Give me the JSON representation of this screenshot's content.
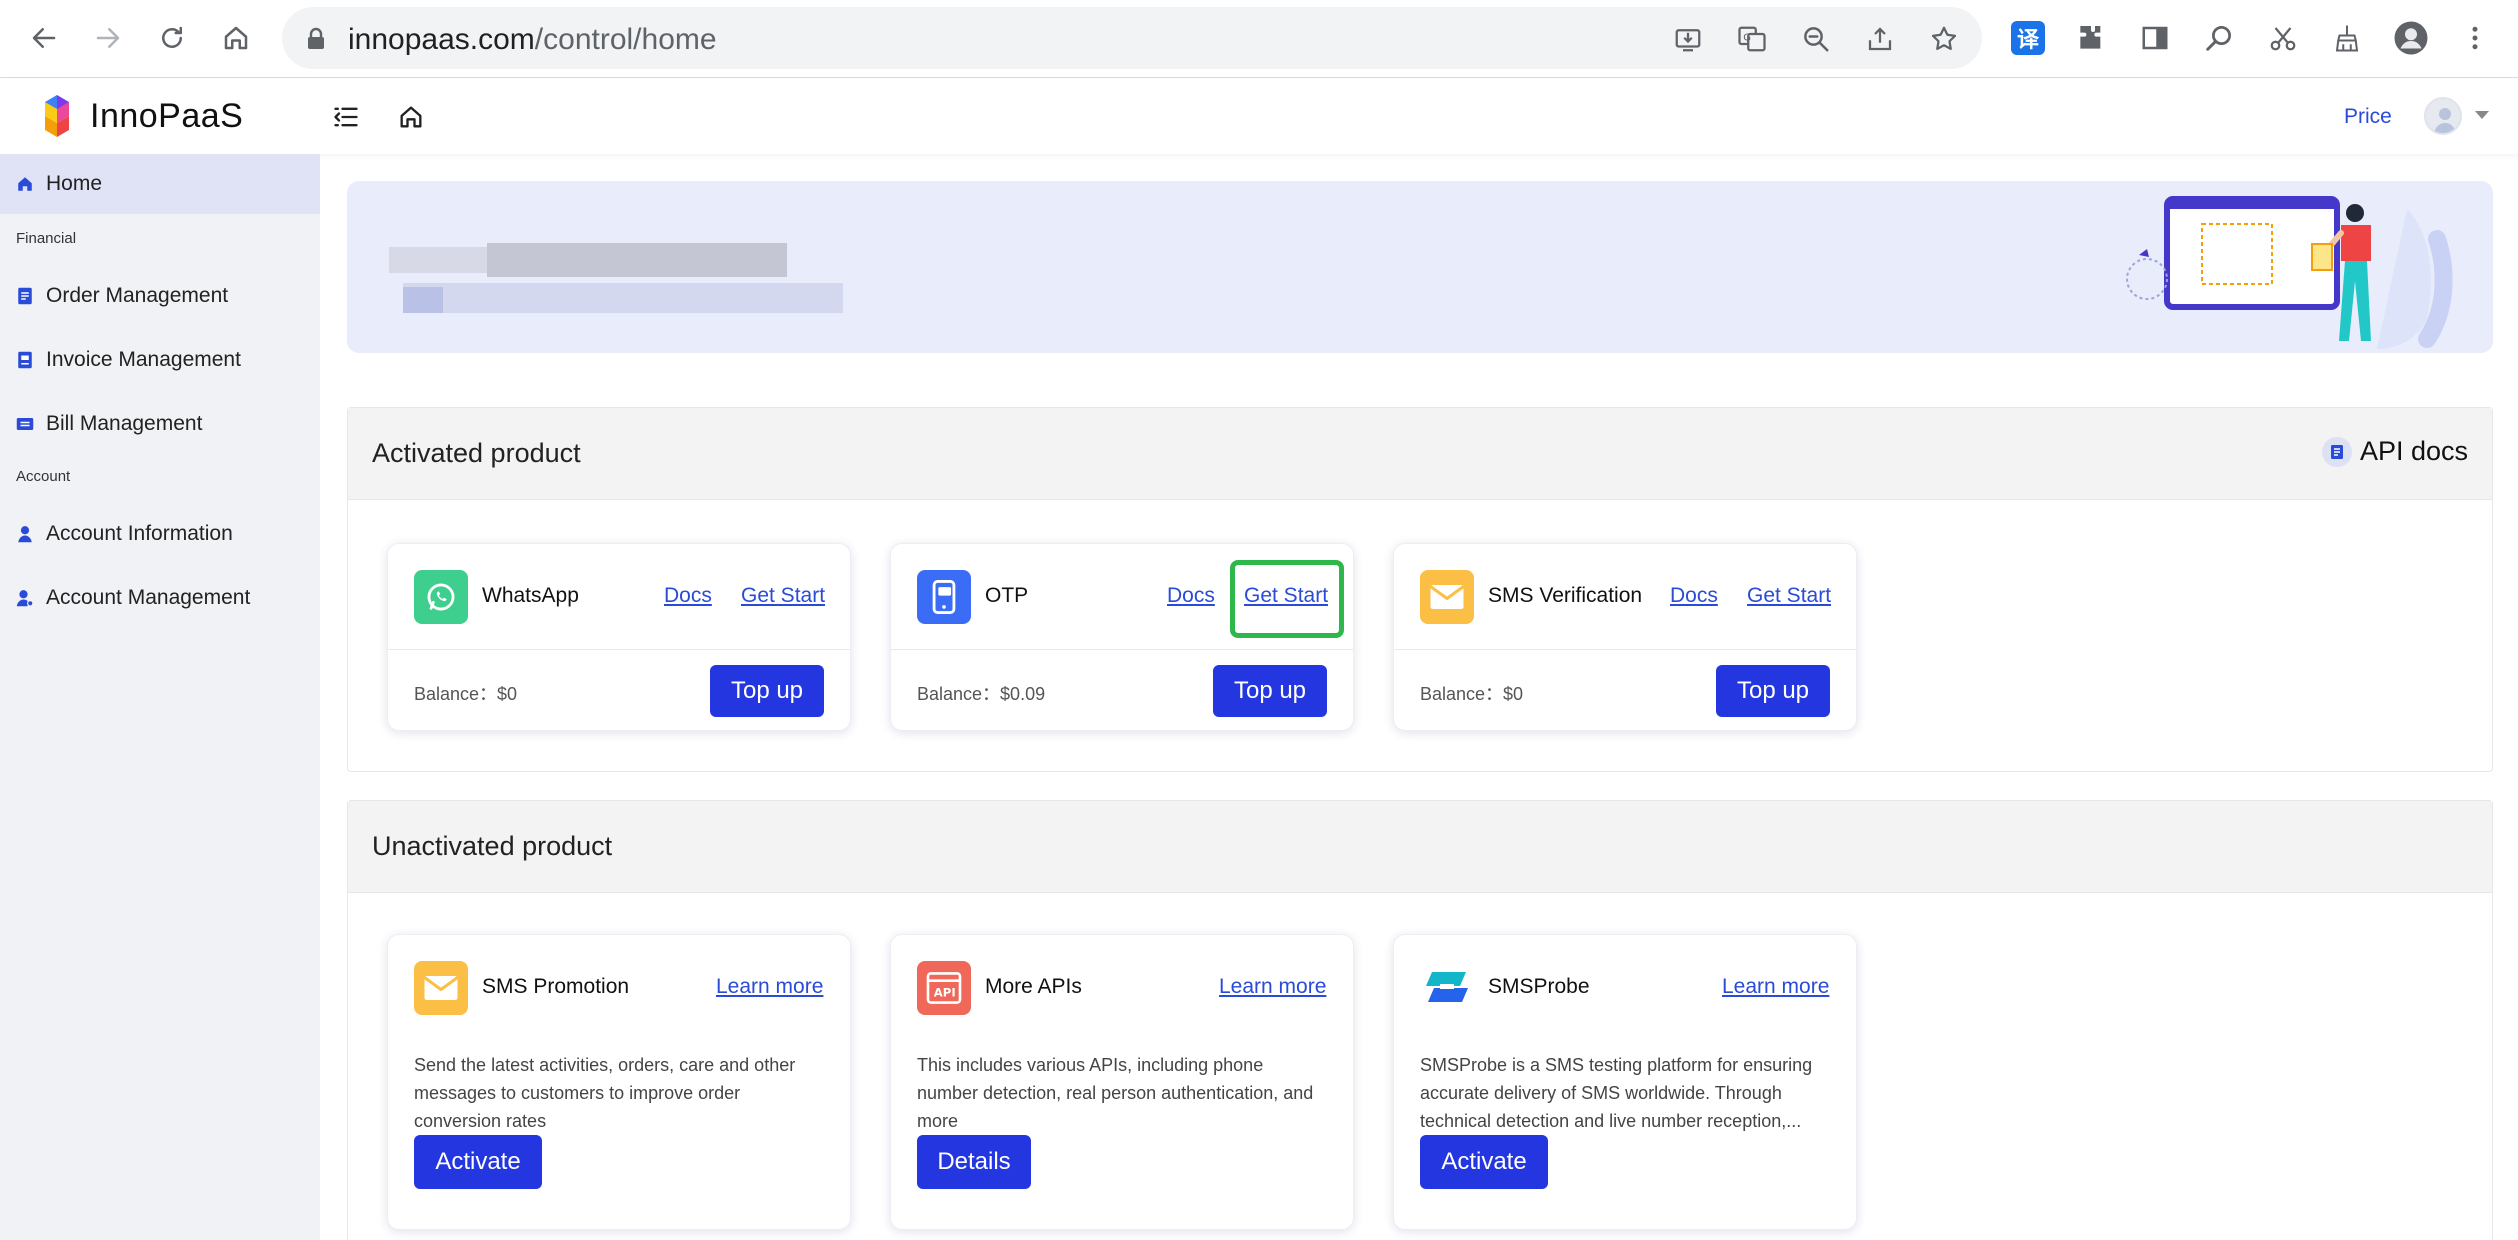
{
  "browser": {
    "url_domain": "innopaas.com",
    "url_path": "/control/home",
    "translate_label": "译"
  },
  "header": {
    "brand": "InnoPaaS",
    "price_link": "Price"
  },
  "sidebar": {
    "home": "Home",
    "group_financial": "Financial",
    "order_management": "Order Management",
    "invoice_management": "Invoice Management",
    "bill_management": "Bill Management",
    "group_account": "Account",
    "account_information": "Account Information",
    "account_management": "Account Management"
  },
  "activated": {
    "title": "Activated product",
    "api_docs": "API docs",
    "products": [
      {
        "name": "WhatsApp",
        "docs": "Docs",
        "get_start": "Get Start",
        "balance": "Balance：$0",
        "topup": "Top up"
      },
      {
        "name": "OTP",
        "docs": "Docs",
        "get_start": "Get Start",
        "balance": "Balance：$0.09",
        "topup": "Top up"
      },
      {
        "name": "SMS Verification",
        "docs": "Docs",
        "get_start": "Get Start",
        "balance": "Balance：$0",
        "topup": "Top up"
      }
    ]
  },
  "unactivated": {
    "title": "Unactivated product",
    "products": [
      {
        "name": "SMS Promotion",
        "learn_more": "Learn more",
        "desc": "Send the latest activities, orders, care and other messages to customers to improve order conversion rates",
        "action": "Activate"
      },
      {
        "name": "More APIs",
        "learn_more": "Learn more",
        "desc": "This includes various APIs, including phone number detection, real person authentication, and more",
        "action": "Details"
      },
      {
        "name": "SMSProbe",
        "learn_more": "Learn more",
        "desc": "SMSProbe is a SMS testing platform for ensuring accurate delivery of SMS worldwide. Through technical detection and live number reception,...",
        "action": "Activate"
      }
    ]
  },
  "colors": {
    "accent": "#2436e0",
    "link": "#2a4bd7",
    "highlight": "#2eb84b",
    "sidebar_bg": "#f1f2f5",
    "banner_bg": "#e8ecfb"
  },
  "icons": {
    "whatsapp": "whatsapp-icon",
    "otp": "phone-otp-icon",
    "sms_verification": "envelope-icon",
    "sms_promotion": "envelope-icon",
    "more_apis": "api-window-icon",
    "smsprobe": "smsprobe-logo"
  }
}
